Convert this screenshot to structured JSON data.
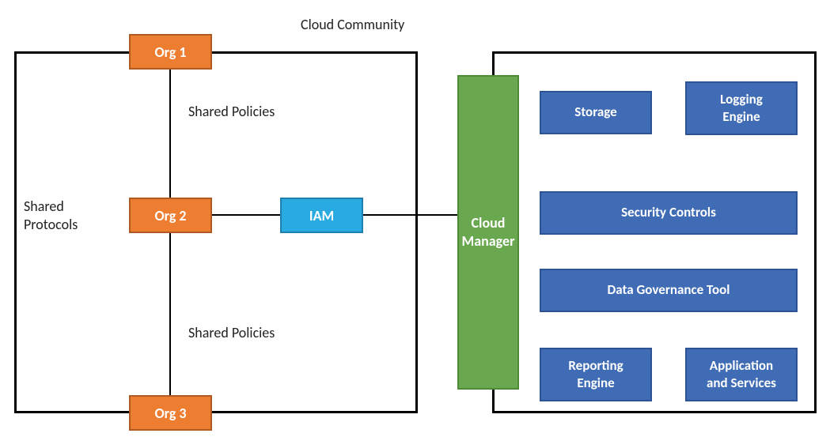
{
  "title": "Cloud Community",
  "left": {
    "org1": "Org 1",
    "org2": "Org 2",
    "org3": "Org 3",
    "shared_protocols": "Shared\nProtocols",
    "shared_policies_top": "Shared Policies",
    "shared_policies_bottom": "Shared Policies",
    "iam": "IAM"
  },
  "right": {
    "cloud_manager": "Cloud\nManager",
    "storage": "Storage",
    "logging_engine": "Logging\nEngine",
    "security_controls": "Security Controls",
    "data_governance": "Data Governance Tool",
    "reporting_engine": "Reporting\nEngine",
    "app_services": "Application\nand Services"
  },
  "colors": {
    "org": "#ed7d31",
    "iam": "#29abe2",
    "cloud_manager": "#6aa84f",
    "service": "#3f6cb4"
  }
}
